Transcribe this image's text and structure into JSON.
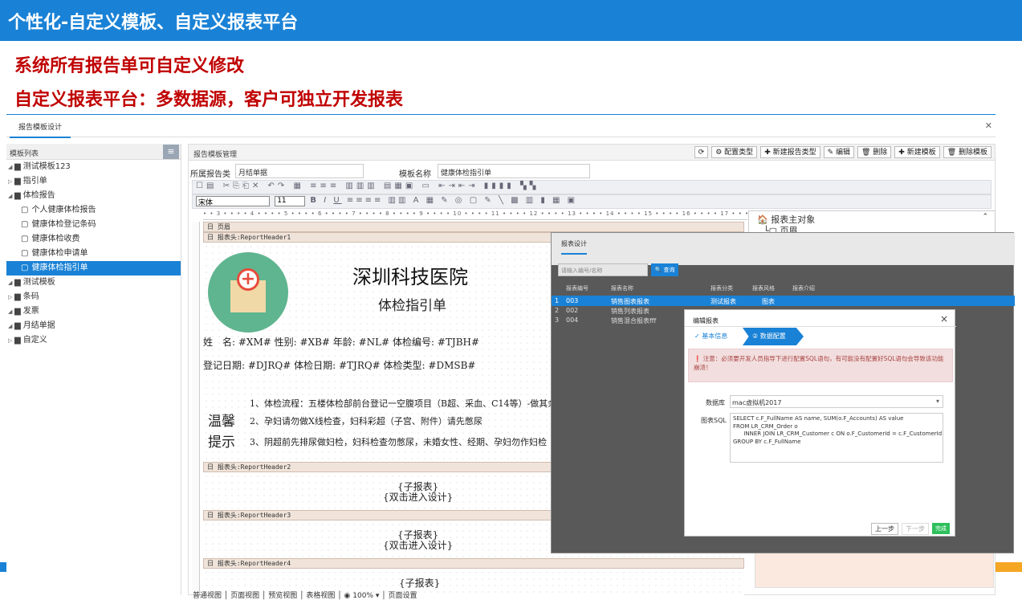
{
  "header": {
    "title": "个性化-自定义模板、自定义报表平台"
  },
  "headlines": [
    "系统所有报告单可自定义修改",
    "自定义报表平台：多数据源，客户可独立开发报表"
  ],
  "app": {
    "tab": "报告模板设计",
    "close": "✕"
  },
  "left": {
    "title": "模板列表",
    "items": [
      {
        "label": "测试模板123",
        "lvl": 0,
        "arrow": "◢"
      },
      {
        "label": "指引单",
        "lvl": 0,
        "arrow": "▷"
      },
      {
        "label": "体检报告",
        "lvl": 0,
        "arrow": "◢"
      },
      {
        "label": "个人健康体检报告",
        "lvl": 1
      },
      {
        "label": "健康体检登记条码",
        "lvl": 1
      },
      {
        "label": "健康体检收费",
        "lvl": 1
      },
      {
        "label": "健康体检申请单",
        "lvl": 1
      },
      {
        "label": "健康体检指引单",
        "lvl": 1,
        "sel": true
      },
      {
        "label": "测试模板",
        "lvl": 0,
        "arrow": "◢"
      },
      {
        "label": "条码",
        "lvl": 0,
        "arrow": "▷"
      },
      {
        "label": "发票",
        "lvl": 0,
        "arrow": "◢"
      },
      {
        "label": "月结单据",
        "lvl": 0,
        "arrow": "◢"
      },
      {
        "label": "自定义",
        "lvl": 0,
        "arrow": "▷"
      }
    ]
  },
  "right": {
    "title": "报告模板管理",
    "buttons": [
      "⟳",
      "⚙ 配置类型",
      "✚ 新建报告类型",
      "✎ 编辑",
      "🗑 删除",
      "✚ 新建模板",
      "🗑 删除模板"
    ],
    "form": {
      "type_label": "所属报告类",
      "type_value": "月结单据",
      "name_label": "模板名称",
      "name_value": "健康体检指引单"
    },
    "font": "宋体",
    "fontsize": "11"
  },
  "report": {
    "band_page": "日 页眉",
    "band1": "日 报表头:ReportHeader1",
    "band2": "日 报表头:ReportHeader2",
    "band3": "日 报表头:ReportHeader3",
    "band4": "日 报表头:ReportHeader4",
    "hospital": "深圳科技医院",
    "guide": "体检指引单",
    "row1": "姓　名: #XM#   性别: #XB# 年龄: #NL# 体检编号: #TJBH#",
    "row2": "登记日期: #DJRQ#   体检日期: #TJRQ#   体检类型: #DMSB#",
    "warm": "温馨\n提示",
    "tips": [
      "1、体检流程：五楼体检部前台登记一空腹项目（B超、采血、C14等）-做其余项",
      "2、孕妇请勿做X线检查，妇科彩超（子宫、附件）请先憋尿",
      "3、阴超前先排尿做妇检，妇科检查勿憋尿，未婚女性、经期、孕妇勿作妇检"
    ],
    "sub1": "{子报表}\n{双击进入设计}",
    "sub2": "{子报表}\n{双击进入设计}",
    "sub3": "{子报表}"
  },
  "object_panel": {
    "title": "报表主对象",
    "child": "页眉"
  },
  "bottom": "普通视图 │ 页面视图 │ 预览视图 │ 表格视图 │  ◉ 100%  ▾ │ 页面设置",
  "overlay": {
    "tab": "报表设计",
    "search_placeholder": "请输入编号/名称",
    "search_btn": "🔍 查询",
    "cols": [
      "报表编号",
      "报表名称",
      "报表分类",
      "报表风格",
      "报表介绍"
    ],
    "rows": [
      {
        "n": "1",
        "code": "003",
        "name": "销售图表报表",
        "cat": "测试报表",
        "style": "图表"
      },
      {
        "n": "2",
        "code": "002",
        "name": "销售列表报表",
        "cat": "",
        "style": ""
      },
      {
        "n": "3",
        "code": "004",
        "name": "销售混合报表fff",
        "cat": "",
        "style": ""
      }
    ]
  },
  "dialog": {
    "title": "编辑报表",
    "step1": "✓ 基本信息",
    "step2": "② 数据配置",
    "warning": "❗ 注意：必须要开发人员指导下进行配置SQL语句，有可能没有配置好SQL语句会导致该功能崩溃！",
    "db_label": "数据库",
    "db_value": "mac虚拟机2017",
    "sql_label": "图表SQL",
    "sql": "SELECT c.F_FullName AS name, SUM(o.F_Accounts) AS value\nFROM LR_CRM_Order o\n      INNER JOIN LR_CRM_Customer c ON o.F_CustomerId = c.F_CustomerId\nGROUP BY c.F_FullName",
    "prev": "上一步",
    "next": "下一步",
    "done": "完成"
  }
}
